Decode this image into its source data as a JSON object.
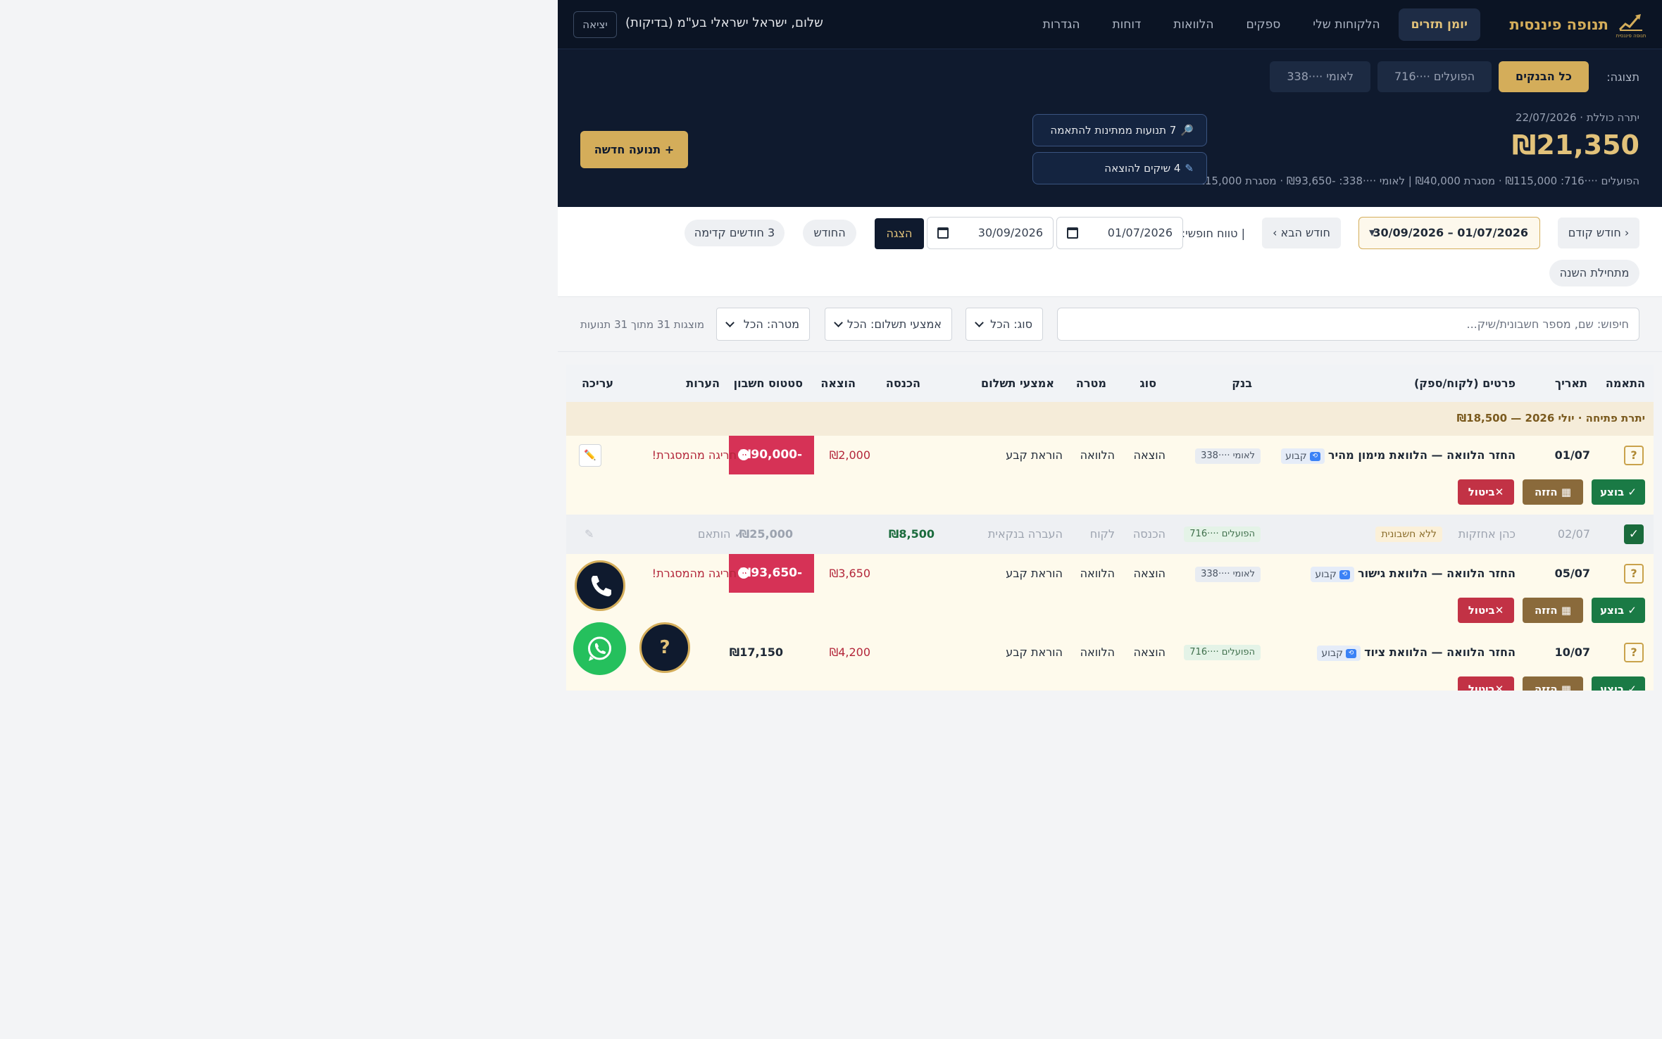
{
  "topnav": {
    "brand_name": "תנופה פיננסית",
    "logo_caption": "תנופה פיננסית",
    "items": [
      {
        "label": "יומן תזרים",
        "active": true
      },
      {
        "label": "הלקוחות שלי"
      },
      {
        "label": "ספקים"
      },
      {
        "label": "הלוואות"
      },
      {
        "label": "דוחות"
      },
      {
        "label": "הגדרות"
      }
    ],
    "greeting": "שלום, ישראל ישראלי בע\"מ (בדיקות)",
    "logout": "יציאה"
  },
  "header": {
    "view_label": "תצוגה:",
    "view_tabs": [
      "כל הבנקים",
      "הפועלים ····716",
      "לאומי ····338"
    ],
    "balance_caption": "יתרה כוללת · 22/07/2026",
    "balance_amount": "₪21,350",
    "balance_breakdown": "הפועלים ····716: ₪115,000 · מסגרת ₪40,000 | לאומי ····338: -₪93,650 · מסגרת ₪15,000",
    "pending_match": "7 תנועות ממתינות להתאמה",
    "checks_to_post": "4 שיקים להוצאה",
    "new_transaction": "+ תנועה חדשה",
    "colors": {
      "accent": "#d4ad5a",
      "navy": "#0f1a2e"
    }
  },
  "daterow": {
    "prev_month": "‹ חודש קודם",
    "range": "01/07/2026 – 30/09/2026",
    "next_month": "חודש הבא ›",
    "free_range_label": "| טווח חופשי:",
    "date_from": "01/07/2026",
    "date_to": "30/09/2026",
    "show": "הצגה",
    "this_month": "החודש",
    "three_months": "3 חודשים קדימה",
    "year_start": "מתחילת השנה"
  },
  "filters": {
    "search_placeholder": "חיפוש: שם, מספר חשבונית/שיק...",
    "type": "סוג: הכל",
    "payment": "אמצעי תשלום: הכל",
    "purpose": "מטרה: הכל",
    "count": "מוצגות 31 מתוך 31 תנועות"
  },
  "table": {
    "headers": [
      "התאמה",
      "תאריך",
      "פרטים (לקוח/ספק)",
      "בנק",
      "סוג",
      "מטרה",
      "אמצעי תשלום",
      "הכנסה",
      "הוצאה",
      "סטטוס חשבון",
      "הערות",
      "עריכה"
    ],
    "opening": "יתרת פתיחה · יולי 2026 — ₪18,500",
    "fixed_tag": "קבוע",
    "no_invoice_tag": "ללא חשבונית",
    "actions": {
      "done": "✓ בוצע",
      "post": "הזזה",
      "cancel": "ביטול"
    },
    "rows": [
      {
        "date": "01/07",
        "name": "החזר הלוואה — הלוואת מימון מהיר",
        "bank": "לאומי ····338",
        "type": "הוצאה",
        "purpose": "הלוואה",
        "payment": "הוראת קבע",
        "income": "",
        "expense": "₪2,000",
        "balance": "-₪90,000",
        "note": "חריגה מהמסגרת!"
      },
      {
        "date": "02/07",
        "name": "כהן אחזקות",
        "bank": "הפועלים ····716",
        "type": "הכנסה",
        "purpose": "לקוח",
        "payment": "העברה בנקאית",
        "income": "₪8,500",
        "expense": "",
        "balance": "₪25,000",
        "note": "✓ הותאם"
      },
      {
        "date": "05/07",
        "name": "החזר הלוואה — הלוואת גישור",
        "bank": "לאומי ····338",
        "type": "הוצאה",
        "purpose": "הלוואה",
        "payment": "הוראת קבע",
        "income": "",
        "expense": "₪3,650",
        "balance": "-₪93,650",
        "note": "חריגה מהמסגרת!"
      },
      {
        "date": "10/07",
        "name": "החזר הלוואה — הלוואת ציוד",
        "bank": "הפועלים ····716",
        "type": "הוצאה",
        "purpose": "הלוואה",
        "payment": "הוראת קבע",
        "income": "",
        "expense": "₪4,200",
        "balance": "₪17,150",
        "note": ""
      }
    ]
  }
}
